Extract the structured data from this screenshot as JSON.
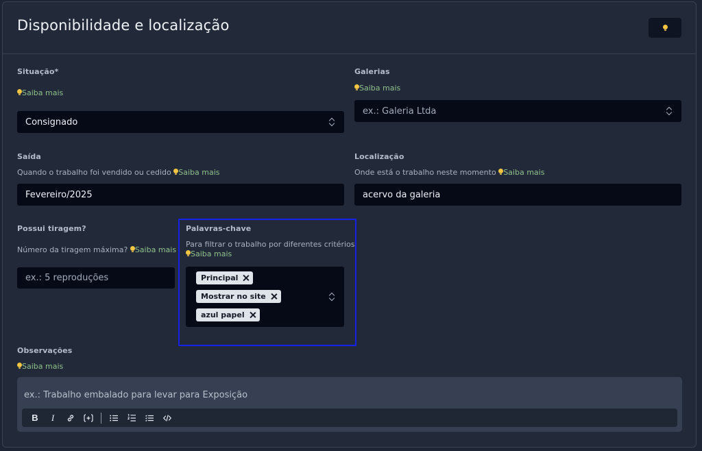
{
  "header": {
    "title": "Disponibilidade e localização",
    "hint_icon": "lightbulb-icon"
  },
  "help_link": "Saiba mais",
  "situacao": {
    "label": "Situação*",
    "value": "Consignado"
  },
  "galerias": {
    "label": "Galerias",
    "placeholder": "ex.: Galeria Ltda"
  },
  "saida": {
    "label": "Saída",
    "help": "Quando o trabalho foi vendido ou cedido",
    "value": "Fevereiro/2025"
  },
  "localizacao": {
    "label": "Localização",
    "help": "Onde está o trabalho neste momento",
    "value": "acervo da galeria"
  },
  "tiragem": {
    "label": "Possui tiragem?",
    "help": "Número da tiragem máxima?",
    "placeholder": "ex.: 5 reproduções"
  },
  "palavras": {
    "label": "Palavras-chave",
    "help": "Para filtrar o trabalho por diferentes critérios",
    "tags": [
      "Principal",
      "Mostrar no site",
      "azul papel"
    ]
  },
  "observacoes": {
    "label": "Observações",
    "placeholder": "ex.: Trabalho embalado para levar para Exposição",
    "toolbar": [
      "bold",
      "italic",
      "link",
      "variable",
      "bullet-list",
      "numbered-list",
      "task-list",
      "code"
    ]
  },
  "colors": {
    "accent_link": "#8fc08a",
    "highlight": "#1522e6",
    "bulb": "#f4c542"
  }
}
